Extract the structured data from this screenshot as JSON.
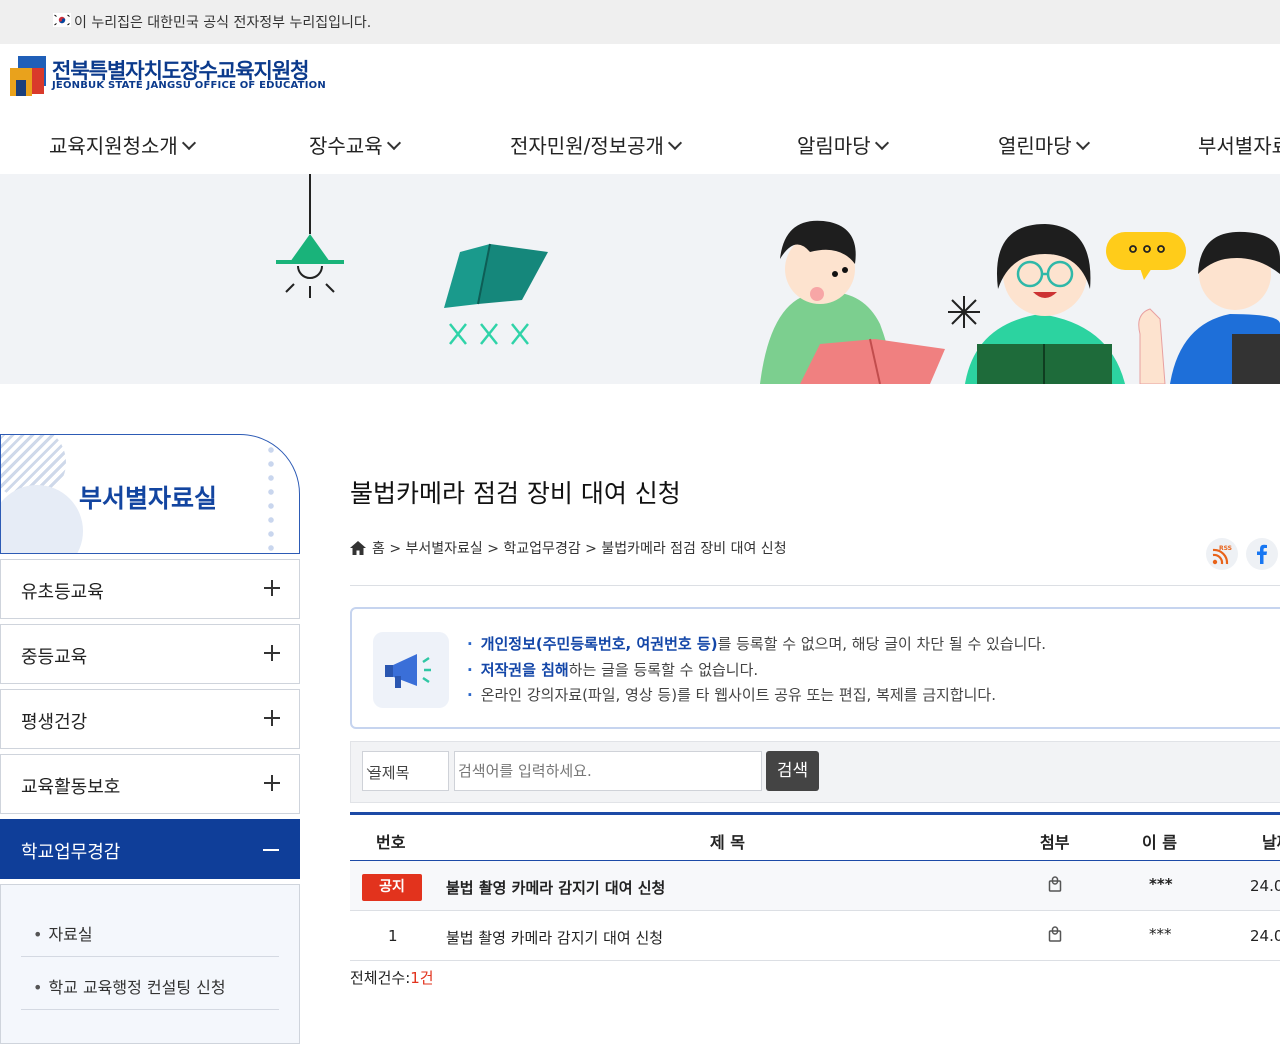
{
  "topbar": {
    "gov_notice": "이 누리집은 대한민국 공식 전자정부 누리집입니다."
  },
  "header": {
    "logo_kr": "전북특별자치도장수교육지원청",
    "logo_en": "JEONBUK STATE JANGSU OFFICE OF EDUCATION",
    "nav": [
      "교육지원청소개",
      "장수교육",
      "전자민원/정보공개",
      "알림마당",
      "열린마당",
      "부서별자료"
    ]
  },
  "sidebar": {
    "title": "부서별자료실",
    "items": [
      {
        "label": "유초등교육"
      },
      {
        "label": "중등교육"
      },
      {
        "label": "평생건강"
      },
      {
        "label": "교육활동보호"
      },
      {
        "label": "학교업무경감"
      }
    ],
    "subitems": [
      {
        "label": "자료실"
      },
      {
        "label": "학교 교육행정 컨설팅 신청"
      }
    ]
  },
  "content": {
    "page_title": "불법카메라 점검 장비 대여 신청",
    "breadcrumb": "홈 > 부서별자료실 > 학교업무경감 > 불법카메라 점검 장비 대여 신청",
    "notices": [
      {
        "bold": "개인정보(주민등록번호, 여권번호 등)",
        "rest": "를 등록할 수 없으며, 해당 글이 차단 될 수 있습니다."
      },
      {
        "bold": "저작권을 침해",
        "rest": "하는 글을 등록할 수 없습니다."
      },
      {
        "bold": "",
        "rest": "온라인 강의자료(파일, 영상 등)를 타 웹사이트 공유 또는 편집, 복제를 금지합니다."
      }
    ],
    "search": {
      "select_value": "글제목",
      "placeholder": "검색어를 입력하세요.",
      "button": "검색"
    },
    "table": {
      "headers": [
        "번호",
        "제 목",
        "첨부",
        "이 름",
        "날짜"
      ],
      "rows": [
        {
          "num": "공지",
          "title": "불법 촬영 카메라 감지기 대여 신청",
          "name": "***",
          "date": "24.0"
        },
        {
          "num": "1",
          "title": "불법 촬영 카메라 감지기 대여 신청",
          "name": "***",
          "date": "24.0"
        }
      ]
    },
    "total_label": "전체건수:",
    "total_value": "1건"
  },
  "colors": {
    "primary": "#0f3e99",
    "accent_red": "#e2331d",
    "banner_bg": "#f1f3f6"
  }
}
